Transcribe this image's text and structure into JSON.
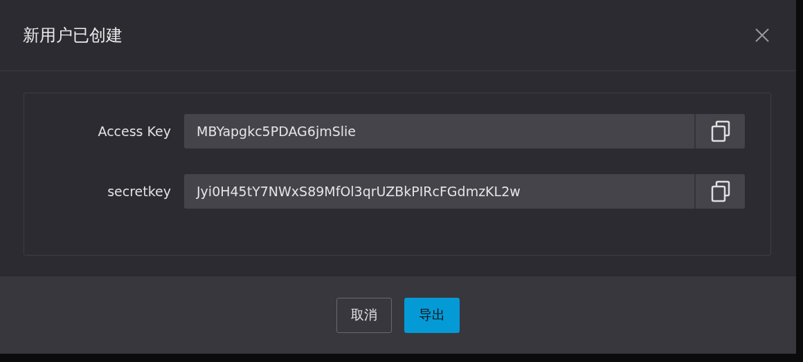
{
  "dialog": {
    "title": "新用户已创建"
  },
  "fields": [
    {
      "label": "Access Key",
      "value": "MBYapgkc5PDAG6jmSlie"
    },
    {
      "label": "secretkey",
      "value": "Jyi0H45tY7NWxS89MfOl3qrUZBkPIRcFGdmzKL2w"
    }
  ],
  "buttons": [
    {
      "label": "取消",
      "kind": "secondary"
    },
    {
      "label": "导出",
      "kind": "primary"
    }
  ]
}
